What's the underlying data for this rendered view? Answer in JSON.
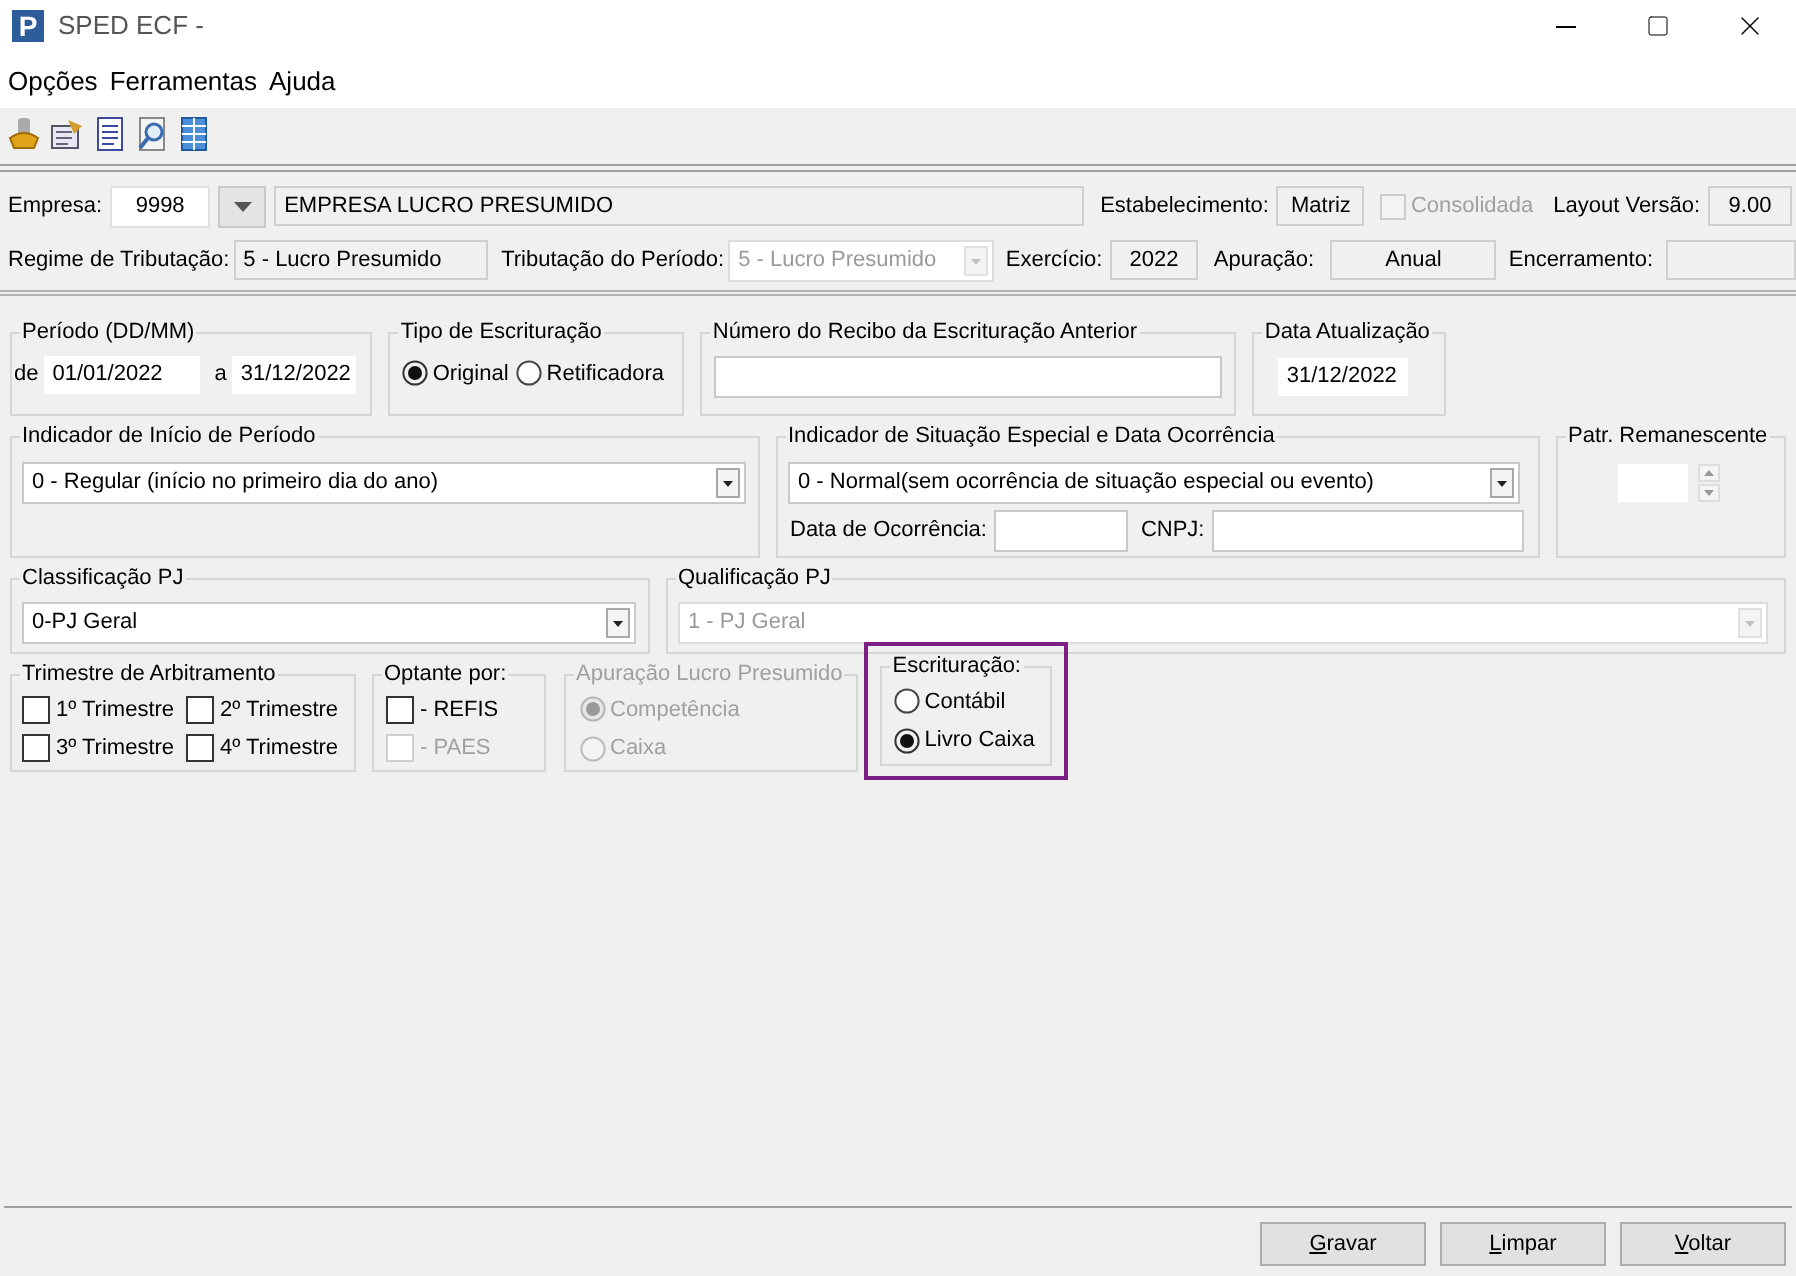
{
  "window": {
    "icon_text": "P",
    "title": "SPED ECF -"
  },
  "menu": [
    {
      "label": "Opções"
    },
    {
      "label": "Ferramentas"
    },
    {
      "label": "Ajuda"
    }
  ],
  "header": {
    "empresa": {
      "label": "Empresa:",
      "code": "9998",
      "name": "EMPRESA LUCRO PRESUMIDO"
    },
    "estabelecimento": {
      "label": "Estabelecimento:",
      "value": "Matriz"
    },
    "consolidada": {
      "label": "Consolidada",
      "checked": false,
      "disabled": true
    },
    "layout_versao": {
      "label": "Layout Versão:",
      "value": "9.00"
    },
    "regime": {
      "label": "Regime de Tributação:",
      "value": "5 - Lucro Presumido"
    },
    "tributacao_periodo": {
      "label": "Tributação do Período:",
      "value": "5 - Lucro Presumido",
      "disabled": true
    },
    "exercicio": {
      "label": "Exercício:",
      "value": "2022"
    },
    "apuracao": {
      "label": "Apuração:",
      "value": "Anual"
    },
    "encerramento": {
      "label": "Encerramento:"
    }
  },
  "periodo": {
    "title": "Período (DD/MM)",
    "from_label": "de",
    "from": "01/01/2022",
    "to_label": "a",
    "to": "31/12/2022"
  },
  "tipo_escrituracao": {
    "title": "Tipo de Escrituração",
    "options": [
      {
        "label": "Original",
        "selected": true
      },
      {
        "label": "Retificadora",
        "selected": false
      }
    ]
  },
  "numero_recibo": {
    "title": "Número do Recibo da Escrituração Anterior"
  },
  "data_atualizacao": {
    "title": "Data Atualização",
    "value": "31/12/2022"
  },
  "indicador_inicio": {
    "title": "Indicador de Início de Período",
    "value": "0 - Regular (início no primeiro dia do ano)"
  },
  "indicador_situacao": {
    "title": "Indicador de Situação Especial e Data Ocorrência",
    "value": "0 - Normal(sem ocorrência de situação especial ou evento)",
    "data_label": "Data de Ocorrência:",
    "cnpj_label": "CNPJ:"
  },
  "patr_remanescente": {
    "title": "Patr. Remanescente"
  },
  "classificacao_pj": {
    "title": "Classificação PJ",
    "value": "0-PJ Geral",
    "disabled": false
  },
  "qualificacao_pj": {
    "title": "Qualificação PJ",
    "value": "1 - PJ Geral",
    "disabled": true
  },
  "trimestre": {
    "title": "Trimestre de Arbitramento",
    "items": [
      {
        "label": "1º Trimestre",
        "checked": false
      },
      {
        "label": "2º Trimestre",
        "checked": false
      },
      {
        "label": "3º Trimestre",
        "checked": false
      },
      {
        "label": "4º Trimestre",
        "checked": false
      }
    ]
  },
  "optante": {
    "title": "Optante por:",
    "items": [
      {
        "label": "- REFIS",
        "checked": false,
        "disabled": false
      },
      {
        "label": "- PAES",
        "checked": false,
        "disabled": true
      }
    ]
  },
  "apuracao_lucro": {
    "title": "Apuração Lucro Presumido",
    "disabled": true,
    "options": [
      {
        "label": "Competência",
        "selected": true
      },
      {
        "label": "Caixa",
        "selected": false
      }
    ]
  },
  "escrituracao": {
    "title": "Escrituração:",
    "highlighted": true,
    "options": [
      {
        "label": "Contábil",
        "selected": false
      },
      {
        "label": "Livro Caixa",
        "selected": true
      }
    ]
  },
  "buttons": [
    {
      "label": "Gravar"
    },
    {
      "label": "Limpar"
    },
    {
      "label": "Voltar"
    }
  ]
}
